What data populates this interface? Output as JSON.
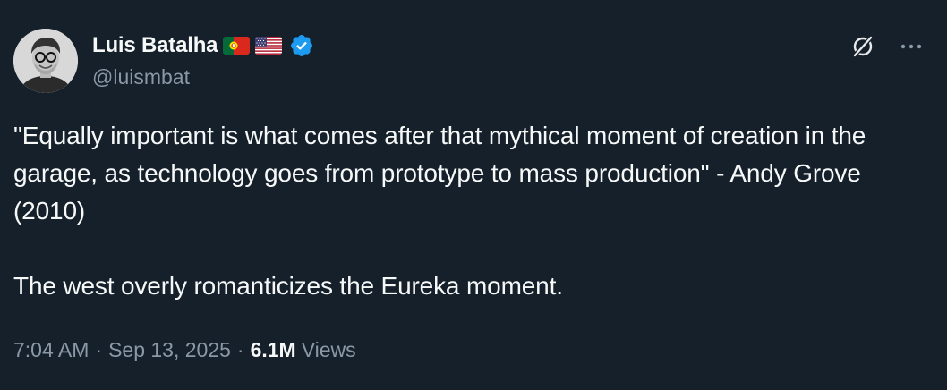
{
  "author": {
    "display_name": "Luis Batalha",
    "handle": "@luismbat",
    "flags": [
      "portugal-flag",
      "usa-flag"
    ],
    "verified": true,
    "verified_color": "#1d9bf0"
  },
  "tweet": {
    "text": "\"Equally important is what comes after that mythical moment of creation in the garage, as technology goes from prototype to mass production\" - Andy Grove (2010)\n\nThe west overly romanticizes the Eureka moment."
  },
  "meta": {
    "time": "7:04 AM",
    "separator": "·",
    "date": "Sep 13, 2025",
    "views_count": "6.1M",
    "views_label": "Views"
  },
  "icons": {
    "grok": "grok-icon",
    "more": "more-icon"
  },
  "colors": {
    "background": "#15202b",
    "text": "#f7f9f9",
    "secondary": "#8b98a5"
  }
}
